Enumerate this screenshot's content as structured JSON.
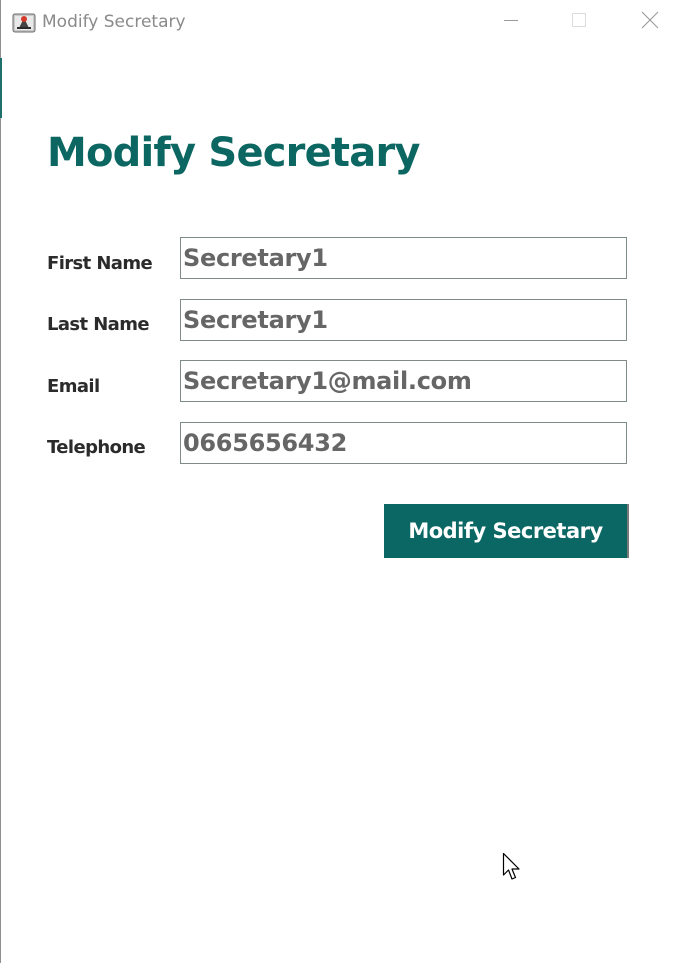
{
  "window": {
    "title": "Modify Secretary",
    "icon": "java-app-icon",
    "controls": [
      "minimize-icon",
      "maximize-icon",
      "close-icon"
    ]
  },
  "form": {
    "heading": "Modify Secretary",
    "fields": [
      {
        "label": "First Name",
        "value": "Secretary1"
      },
      {
        "label": "Last Name",
        "value": "Secretary1"
      },
      {
        "label": "Email",
        "value": "Secretary1@mail.com"
      },
      {
        "label": "Telephone",
        "value": "0665656432"
      }
    ],
    "submit_label": "Modify Secretary"
  },
  "colors": {
    "accent": "#0c6661",
    "button_bg": "#0b6763",
    "label_text": "#2b2b2b",
    "input_text": "#666666",
    "title_text": "#8a8a8a"
  }
}
